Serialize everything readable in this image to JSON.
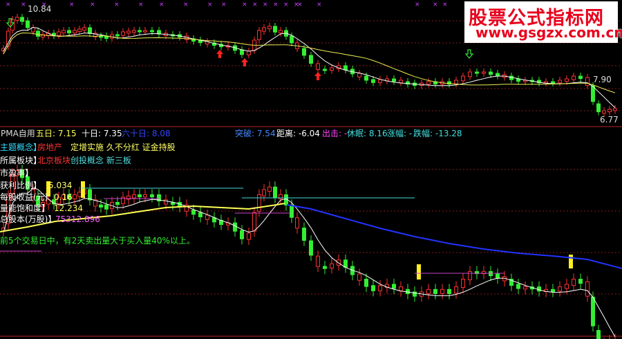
{
  "upper_panel": {
    "top_price": "10.84",
    "right_price_a": "7.90",
    "right_price_b": "6.77"
  },
  "indicator_bar": {
    "name": "PMA自用",
    "ma5_label": "五日: 7.15",
    "ma10_label": "十日: 7.35",
    "ma60_label": "六十日: 8.08",
    "breakout_label": "突破: 7.54",
    "distance_label": "距离: -6.04",
    "exit_label": "出击: -",
    "rest_label": "休眠: 8.16",
    "rise_label": "涨幅: -",
    "fall_label": "跌幅: -13.28"
  },
  "info_lines": {
    "concept_label": "主题概念】",
    "concept_value": "房地产",
    "concept_tags": "定增实施 久不分红 证金持股",
    "sector_label": "所属板块】",
    "sector_value": "北京板块",
    "sector_tags": "创投概念 新三板",
    "pe_label": "市盈率】",
    "profit_ratio_label": "获利比例】",
    "profit_ratio_value": "5.034",
    "eps_label": "每股收益(元)",
    "eps_value": "0.16",
    "kinetic_label": "量能饱和度】",
    "kinetic_value": "12.234",
    "shares_label": "总股本(万股)】",
    "shares_value": "75312.896",
    "note": "前5个交易日中，有2天卖出量大于买入量40%以上。"
  },
  "watermark": {
    "title": "股票公式指标网",
    "url": "www.gsgzx.com.cn"
  },
  "colors": {
    "up": "#ff3232",
    "down": "#33ee33",
    "ma_white": "#ffffff",
    "ma_yellow": "#ffff66",
    "ma_blue": "#2233ff",
    "magenta": "#ff44ff",
    "cyan": "#44dddd"
  }
}
